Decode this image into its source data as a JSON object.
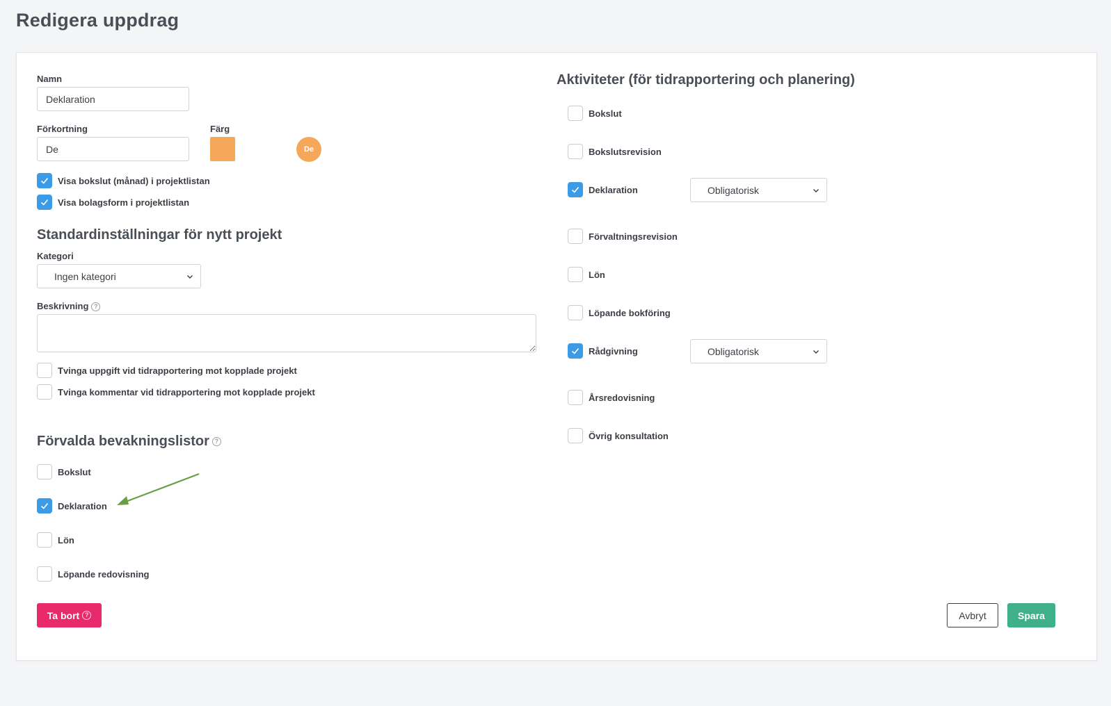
{
  "page": {
    "title": "Redigera uppdrag"
  },
  "form": {
    "name_label": "Namn",
    "name_value": "Deklaration",
    "abbr_label": "Förkortning",
    "abbr_value": "De",
    "color_label": "Färg",
    "color_value": "#f5a85a",
    "avatar_text": "De",
    "options": [
      {
        "label": "Visa bokslut (månad) i projektlistan",
        "checked": true
      },
      {
        "label": "Visa bolagsform i projektlistan",
        "checked": true
      }
    ]
  },
  "defaults": {
    "title": "Standardinställningar för nytt projekt",
    "category_label": "Kategori",
    "category_value": "Ingen kategori",
    "description_label": "Beskrivning",
    "description_value": "",
    "enforce": [
      {
        "label": "Tvinga uppgift vid tidrapportering mot kopplade projekt",
        "checked": false
      },
      {
        "label": "Tvinga kommentar vid tidrapportering mot kopplade projekt",
        "checked": false
      }
    ]
  },
  "watchlists": {
    "title": "Förvalda bevakningslistor",
    "items": [
      {
        "label": "Bokslut",
        "checked": false
      },
      {
        "label": "Deklaration",
        "checked": true
      },
      {
        "label": "Lön",
        "checked": false
      },
      {
        "label": "Löpande redovisning",
        "checked": false
      }
    ]
  },
  "activities": {
    "title": "Aktiviteter (för tidrapportering och planering)",
    "items": [
      {
        "label": "Bokslut",
        "checked": false
      },
      {
        "label": "Bokslutsrevision",
        "checked": false
      },
      {
        "label": "Deklaration",
        "checked": true,
        "requirement": "Obligatorisk"
      },
      {
        "label": "Förvaltningsrevision",
        "checked": false
      },
      {
        "label": "Lön",
        "checked": false
      },
      {
        "label": "Löpande bokföring",
        "checked": false
      },
      {
        "label": "Rådgivning",
        "checked": true,
        "requirement": "Obligatorisk"
      },
      {
        "label": "Årsredovisning",
        "checked": false
      },
      {
        "label": "Övrig konsultation",
        "checked": false
      }
    ]
  },
  "actions": {
    "delete_label": "Ta bort",
    "cancel_label": "Avbryt",
    "save_label": "Spara"
  },
  "colors": {
    "accent_blue": "#3b9be6",
    "danger": "#e8296b",
    "success": "#40b08a",
    "annotation_arrow": "#6a9e44"
  }
}
